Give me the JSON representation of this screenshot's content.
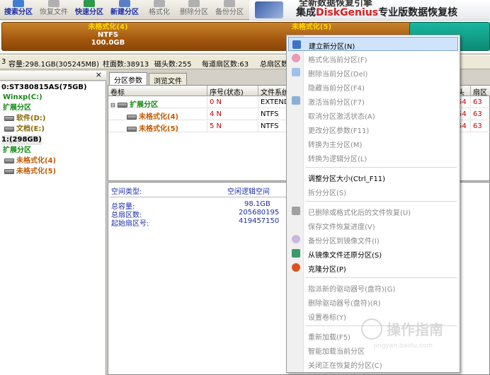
{
  "toolbar": {
    "buttons": [
      {
        "label": "搜索分区",
        "icon": "search-partition-icon",
        "enabled": true
      },
      {
        "label": "恢复文件",
        "icon": "recover-file-icon",
        "enabled": false
      },
      {
        "label": "快速分区",
        "icon": "quick-partition-icon",
        "enabled": true
      },
      {
        "label": "新建分区",
        "icon": "new-partition-icon",
        "enabled": true
      },
      {
        "label": "格式化",
        "icon": "format-icon",
        "enabled": false
      },
      {
        "label": "删除分区",
        "icon": "delete-partition-icon",
        "enabled": false
      },
      {
        "label": "备份分区",
        "icon": "backup-partition-icon",
        "enabled": false
      }
    ],
    "banner_line1": "全新数据恢复引擎",
    "banner_brand_prefix": "集成",
    "banner_brand": "DiskGenius",
    "banner_brand_suffix": "专业版数据恢复核"
  },
  "disk_map": {
    "partition1_name": "未格式化(4)",
    "partition1_fs": "NTFS",
    "partition1_size": "100.0GB",
    "partition2_name": "未格式化(5)",
    "colors": {
      "extended": "#a4580e",
      "free": "#0d8a74",
      "label": "#ffd700"
    }
  },
  "info_strip": {
    "iface": "3",
    "capacity": "容量:298.1GB(305245MB)",
    "cylinders": "柱面数:38913",
    "heads": "磁头数:255",
    "sectors_per_track": "每道扇区数:63",
    "total_sectors": "总扇区数"
  },
  "tree": {
    "disk0": "0:ST380815AS(75GB)",
    "winxp": "Winxp(C:)",
    "ext1": "扩展分区",
    "software": "软件(D:)",
    "docs": "文档(E:)",
    "disk1": "1:(298GB)",
    "ext2": "扩展分区",
    "unf4": "未格式化(4)",
    "unf5": "未格式化(5)"
  },
  "tabs": {
    "params": "分区参数",
    "browse": "浏览文件"
  },
  "grid": {
    "headers": [
      "卷标",
      "序号(状态)",
      "文件系统",
      "头",
      "扇区"
    ],
    "rows": [
      {
        "name": "扩展分区",
        "index": "0 N",
        "fs": "EXTEND",
        "head": "54",
        "sector": "63"
      },
      {
        "name": "未格式化(4)",
        "index": "4 N",
        "fs": "NTFS",
        "head": "54",
        "sector": "63"
      },
      {
        "name": "未格式化(5)",
        "index": "5 N",
        "fs": "NTFS",
        "head": "54",
        "sector": "63"
      }
    ]
  },
  "details": {
    "space_type_label": "空间类型:",
    "space_type_value": "空闲逻辑空间",
    "capacity_label": "总容量:",
    "capacity_value": "98.1GB",
    "sectors_label": "总扇区数:",
    "sectors_value": "205680195",
    "start_label": "起始扇区号:",
    "start_value": "419457150"
  },
  "menu": {
    "items": [
      {
        "label": "建立新分区(N)",
        "icon": "new-partition-icon",
        "enabled": true,
        "highlighted": true
      },
      {
        "label": "格式化当前分区(F)",
        "icon": "format-icon",
        "enabled": false
      },
      {
        "label": "删除当前分区(Del)",
        "icon": "trash-icon",
        "enabled": false
      },
      {
        "label": "隐藏当前分区(F4)",
        "icon": "",
        "enabled": false
      },
      {
        "label": "激活当前分区(F7)",
        "icon": "activate-icon",
        "enabled": false
      },
      {
        "label": "取消分区激活状态(A)",
        "icon": "",
        "enabled": false
      },
      {
        "label": "更改分区参数(F11)",
        "icon": "",
        "enabled": false
      },
      {
        "label": "转换为主分区(M)",
        "icon": "",
        "enabled": false
      },
      {
        "label": "转换为逻辑分区(L)",
        "icon": "",
        "enabled": false
      },
      {
        "label": "调整分区大小(Ctrl_F11)",
        "icon": "",
        "enabled": true
      },
      {
        "label": "拆分分区(S)",
        "icon": "",
        "enabled": false
      },
      {
        "label": "已删除或格式化后的文件恢复(U)",
        "icon": "recover-icon",
        "enabled": false
      },
      {
        "label": "保存文件恢复进度(V)",
        "icon": "",
        "enabled": false
      },
      {
        "label": "备份分区到镜像文件(I)",
        "icon": "backup-icon",
        "enabled": false
      },
      {
        "label": "从镜像文件还原分区(S)",
        "icon": "restore-icon",
        "enabled": true
      },
      {
        "label": "克隆分区(P)",
        "icon": "clone-icon",
        "enabled": true
      },
      {
        "label": "指派新的驱动器号(盘符)(G)",
        "icon": "",
        "enabled": false
      },
      {
        "label": "删除驱动器号(盘符)(R)",
        "icon": "",
        "enabled": false
      },
      {
        "label": "设置卷标(Y)",
        "icon": "",
        "enabled": false
      },
      {
        "label": "重新加载(F5)",
        "icon": "",
        "enabled": false
      },
      {
        "label": "智能加载当前分区",
        "icon": "",
        "enabled": false
      },
      {
        "label": "关闭正在恢复的分区(C)",
        "icon": "",
        "enabled": false
      }
    ]
  },
  "watermark": {
    "text": "操作指南",
    "url": "jingyan.baidu.com"
  }
}
